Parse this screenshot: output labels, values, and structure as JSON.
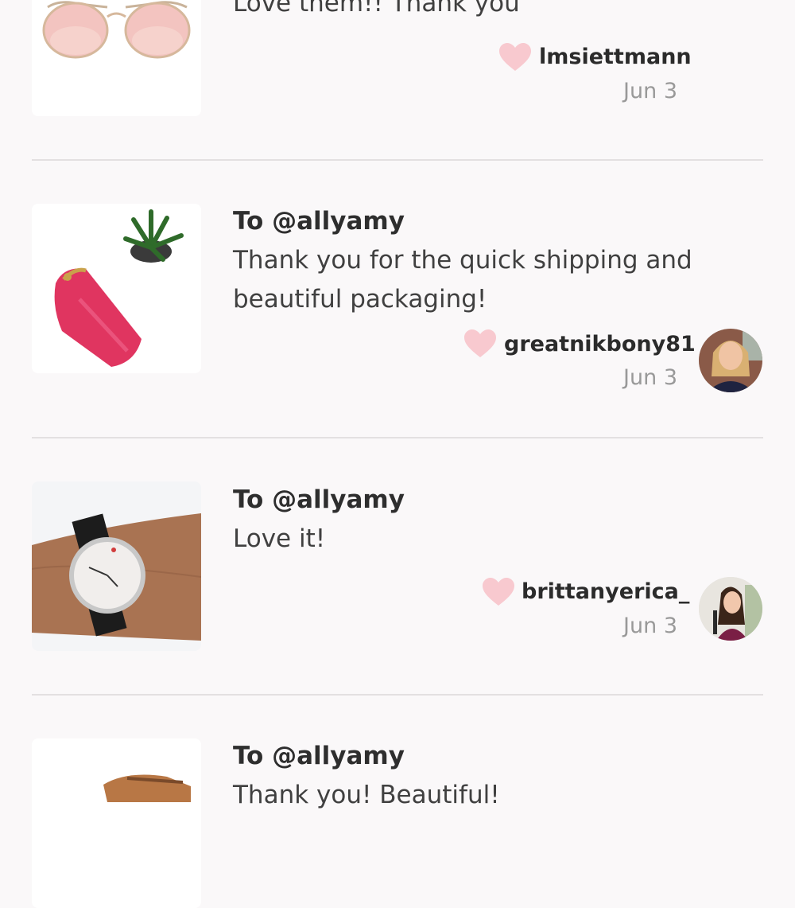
{
  "feedback": [
    {
      "to": "",
      "message": "Love them!! Thank you",
      "user": "lmsiettmann",
      "date": "Jun 3",
      "product_image": "sunglasses",
      "has_avatar": false
    },
    {
      "to": "To @allyamy",
      "message": "Thank you for the quick shipping and beautiful packaging!",
      "user": "greatnikbony81",
      "date": "Jun 3",
      "product_image": "pink-glasses-case-with-succulent",
      "has_avatar": true
    },
    {
      "to": "To @allyamy",
      "message": "Love it!",
      "user": "brittanyerica_",
      "date": "Jun 3",
      "product_image": "watch-on-wrist",
      "has_avatar": true
    },
    {
      "to": "To @allyamy",
      "message": "Thank you! Beautiful!",
      "user": "",
      "date": "",
      "product_image": "brown-leather-item",
      "has_avatar": false
    }
  ],
  "colors": {
    "heart": "#f8c9cf",
    "divider": "#e3e0e1",
    "background": "#faf8f9"
  },
  "icons": [
    "heart-icon"
  ]
}
